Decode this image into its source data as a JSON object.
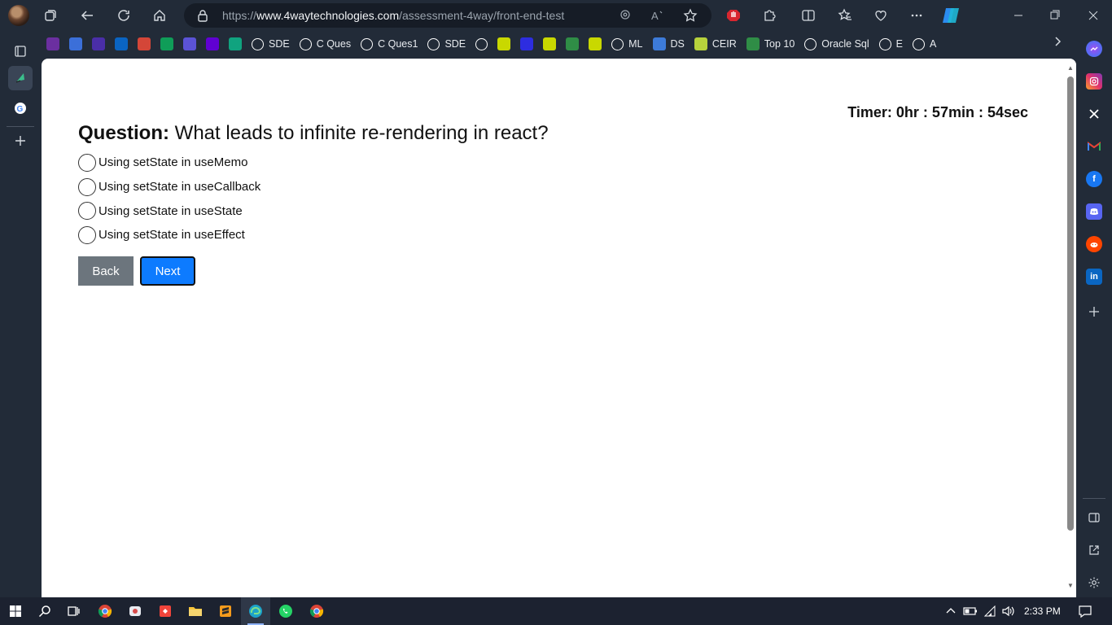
{
  "browser": {
    "url_prefix": "https://",
    "url_domain": "www.4waytechnologies.com",
    "url_path": "/assessment-4way/front-end-test"
  },
  "bookmarks": [
    {
      "icon": "purple-app-icon",
      "label": "",
      "color": "#6b2fa0"
    },
    {
      "icon": "blue-circle-icon",
      "label": "",
      "color": "#3b6fd9"
    },
    {
      "icon": "to-icon",
      "label": "",
      "color": "#4a2ea8"
    },
    {
      "icon": "outlook-icon",
      "label": "",
      "color": "#0a64c2"
    },
    {
      "icon": "gmail-icon",
      "label": "",
      "color": "#d44638"
    },
    {
      "icon": "sheets-icon",
      "label": "",
      "color": "#0f9d58"
    },
    {
      "icon": "link-icon",
      "label": "",
      "color": "#5b53d6"
    },
    {
      "icon": "yahoo-icon",
      "label": "",
      "color": "#6001d2"
    },
    {
      "icon": "chatgpt-icon",
      "label": "",
      "color": "#10a37f"
    },
    {
      "icon": "github-icon",
      "label": "SDE",
      "color": "#ffffff"
    },
    {
      "icon": "github-icon",
      "label": "C Ques",
      "color": "#ffffff"
    },
    {
      "icon": "github-icon",
      "label": "C Ques1",
      "color": "#ffffff"
    },
    {
      "icon": "google-icon",
      "label": "SDE",
      "color": "#ffffff"
    },
    {
      "icon": "google-icon",
      "label": "",
      "color": "#ffffff"
    },
    {
      "icon": "gfg-icon",
      "label": "",
      "color": "#c9d800"
    },
    {
      "icon": "ring-icon",
      "label": "",
      "color": "#2d2de0"
    },
    {
      "icon": "gfg-icon",
      "label": "",
      "color": "#c9d800"
    },
    {
      "icon": "gfg-green-icon",
      "label": "",
      "color": "#2f8d46"
    },
    {
      "icon": "gfg-icon",
      "label": "",
      "color": "#c9d800"
    },
    {
      "icon": "google-icon",
      "label": "ML",
      "color": "#ffffff"
    },
    {
      "icon": "k-icon",
      "label": "DS",
      "color": "#3d7bd9"
    },
    {
      "icon": "ceir-icon",
      "label": "CEIR",
      "color": "#b7d23c"
    },
    {
      "icon": "gfg-green-icon",
      "label": "Top 10",
      "color": "#2f8d46"
    },
    {
      "icon": "page-icon",
      "label": "Oracle Sql",
      "color": "#ffffff"
    },
    {
      "icon": "g-icon",
      "label": "E",
      "color": "#ffffff"
    },
    {
      "icon": "google-icon",
      "label": "A",
      "color": "#ffffff"
    }
  ],
  "page": {
    "timer": "Timer: 0hr : 57min : 54sec",
    "question_label": "Question:",
    "question_text": " What leads to infinite re-rendering in react?",
    "options": [
      "Using setState in useMemo",
      "Using setState in useCallback",
      "Using setState in useState",
      "Using setState in useEffect"
    ],
    "back_label": "Back",
    "next_label": "Next"
  },
  "taskbar": {
    "time": "2:33 PM"
  },
  "colors": {
    "next_button": "#0d7bff",
    "back_button": "#6c757d",
    "browser_chrome": "#222b38"
  }
}
